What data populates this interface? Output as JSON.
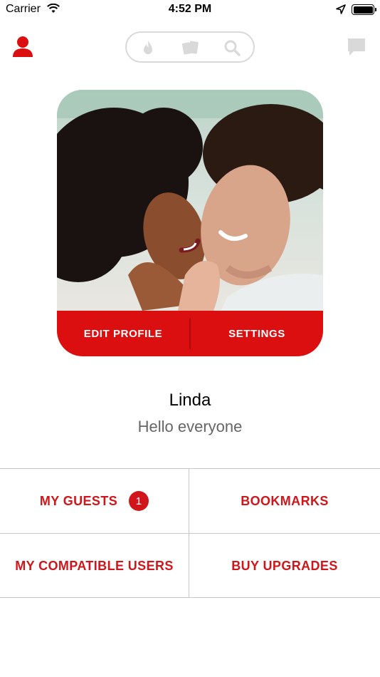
{
  "status_bar": {
    "carrier": "Carrier",
    "time": "4:52 PM",
    "icons": [
      "wifi-icon",
      "location-arrow-icon",
      "battery-icon"
    ]
  },
  "nav": {
    "left_icon": "user-icon",
    "pill_icons": [
      "flame-icon",
      "cards-icon",
      "search-icon"
    ],
    "right_icon": "chat-icon"
  },
  "profile": {
    "photo_description": "couple-photo",
    "edit_label": "EDIT PROFILE",
    "settings_label": "SETTINGS",
    "name": "Linda",
    "status": "Hello everyone"
  },
  "menu": {
    "guests_label": "MY GUESTS",
    "guests_count": "1",
    "bookmarks_label": "BOOKMARKS",
    "compatible_label": "MY COMPATIBLE USERS",
    "upgrades_label": "BUY UPGRADES"
  },
  "colors": {
    "accent": "#dc0f10",
    "menu_text": "#d0161a",
    "inactive_icon": "#d9d9d9"
  }
}
